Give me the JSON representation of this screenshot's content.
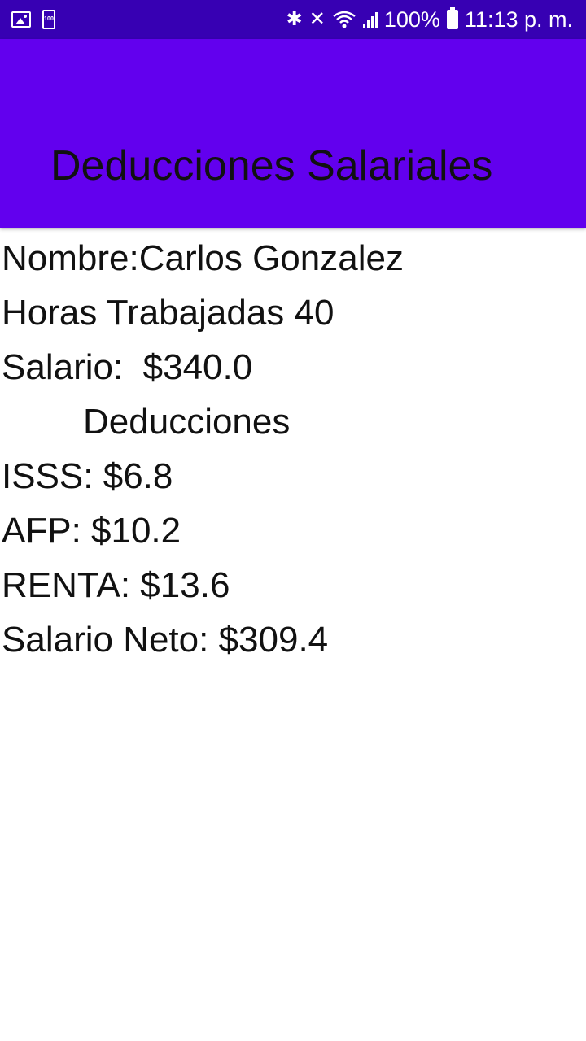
{
  "status_bar": {
    "left_icons": [
      "image-icon",
      "battery-100-icon"
    ],
    "battery_badge": "100",
    "battery_percent": "100%",
    "time": "11:13 p. m."
  },
  "app_bar": {
    "title": "Deducciones Salariales"
  },
  "details": {
    "name": "Nombre:Carlos Gonzalez",
    "hours": "Horas Trabajadas 40",
    "salary": "Salario:  $340.0",
    "deductions_header": "Deducciones",
    "isss": "ISSS: $6.8",
    "afp": "AFP: $10.2",
    "renta": "RENTA: $13.6",
    "net_salary": "Salario Neto: $309.4"
  },
  "colors": {
    "status_bar": "#3700B3",
    "app_bar": "#6200EE"
  }
}
